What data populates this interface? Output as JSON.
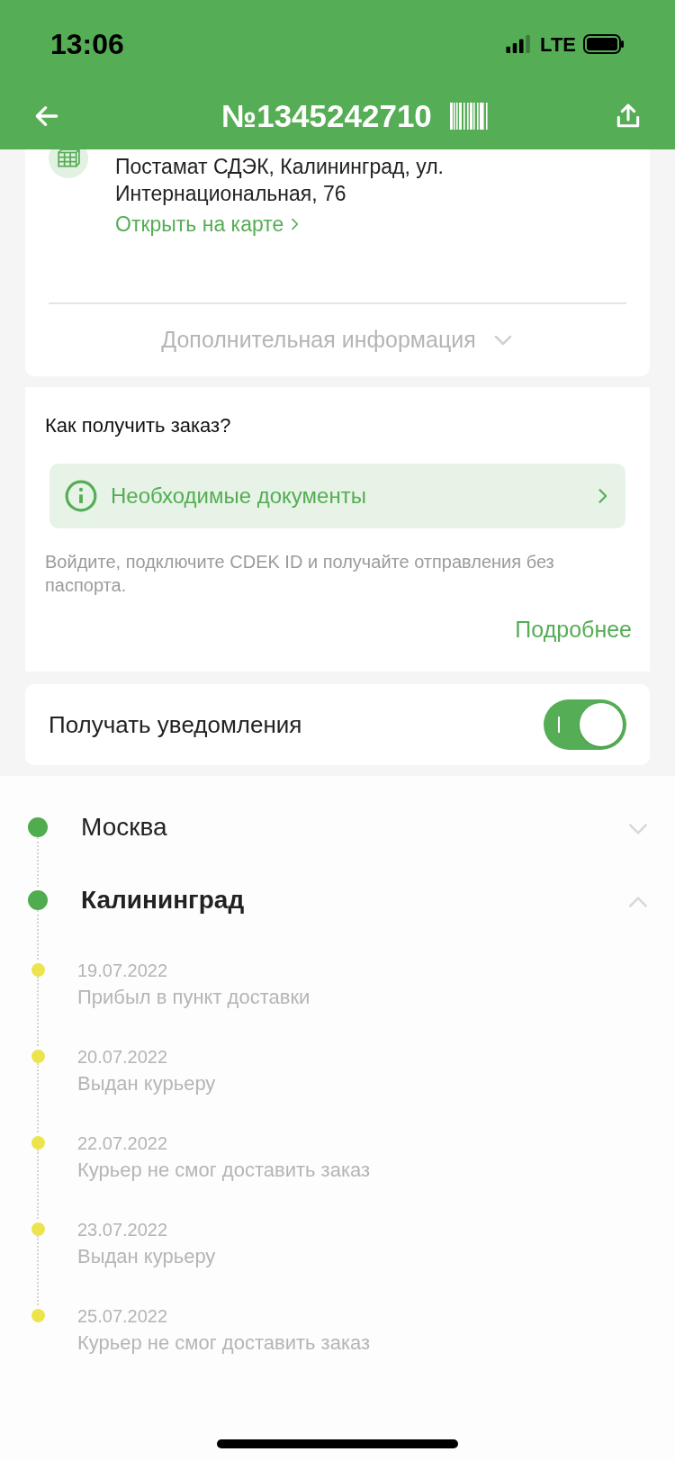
{
  "status_bar": {
    "time": "13:06",
    "network": "LTE"
  },
  "header": {
    "title": "№1345242710"
  },
  "address_card": {
    "address": "Постамат СДЭК, Калининград, ул. Интернациональная, 76",
    "map_link": "Открыть на карте",
    "more_info": {
      "label": "Дополнительная информация",
      "expanded": false
    }
  },
  "pickup_card": {
    "title": "Как получить заказ?",
    "documents_button": "Необходимые документы",
    "note": "Войдите, подключите CDEK ID и получайте отправления без паспорта.",
    "more_link": "Подробнее"
  },
  "notifications": {
    "label": "Получать уведомления",
    "on": true
  },
  "timeline": [
    {
      "city": "Москва",
      "expanded": false
    },
    {
      "city": "Калининград",
      "expanded": true,
      "events": [
        {
          "date": "19.07.2022",
          "status": "Прибыл в пункт доставки"
        },
        {
          "date": "20.07.2022",
          "status": "Выдан курьеру"
        },
        {
          "date": "22.07.2022",
          "status": "Курьер не смог доставить заказ"
        },
        {
          "date": "23.07.2022",
          "status": "Выдан курьеру"
        },
        {
          "date": "25.07.2022",
          "status": "Курьер не смог доставить заказ"
        }
      ]
    }
  ]
}
